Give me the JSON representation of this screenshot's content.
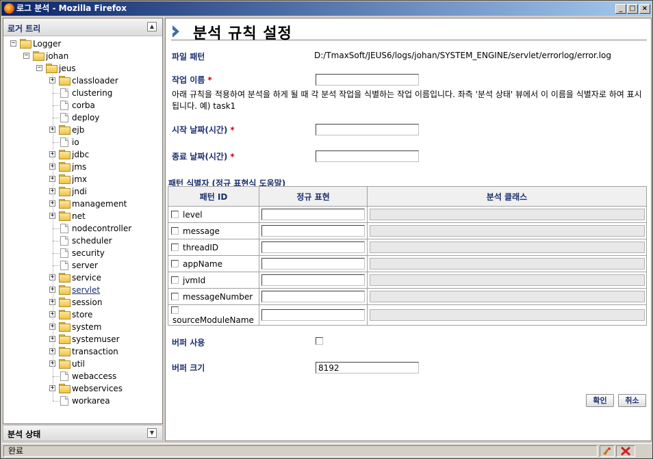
{
  "window": {
    "title": "로그 분석 - Mozilla Firefox"
  },
  "left": {
    "header": "로거 트리",
    "bottom_header": "분석 상태",
    "tree": [
      {
        "label": "Logger",
        "level": 0,
        "kind": "folder",
        "expander": "minus"
      },
      {
        "label": "johan",
        "level": 1,
        "kind": "folder",
        "expander": "minus"
      },
      {
        "label": "jeus",
        "level": 2,
        "kind": "folder",
        "expander": "minus"
      },
      {
        "label": "classloader",
        "level": 3,
        "kind": "folder",
        "expander": "plus"
      },
      {
        "label": "clustering",
        "level": 3,
        "kind": "doc",
        "expander": ""
      },
      {
        "label": "corba",
        "level": 3,
        "kind": "doc",
        "expander": ""
      },
      {
        "label": "deploy",
        "level": 3,
        "kind": "doc",
        "expander": ""
      },
      {
        "label": "ejb",
        "level": 3,
        "kind": "folder",
        "expander": "plus"
      },
      {
        "label": "io",
        "level": 3,
        "kind": "doc",
        "expander": ""
      },
      {
        "label": "jdbc",
        "level": 3,
        "kind": "folder",
        "expander": "plus"
      },
      {
        "label": "jms",
        "level": 3,
        "kind": "folder",
        "expander": "plus"
      },
      {
        "label": "jmx",
        "level": 3,
        "kind": "folder",
        "expander": "plus"
      },
      {
        "label": "jndi",
        "level": 3,
        "kind": "folder",
        "expander": "plus"
      },
      {
        "label": "management",
        "level": 3,
        "kind": "folder",
        "expander": "plus"
      },
      {
        "label": "net",
        "level": 3,
        "kind": "folder",
        "expander": "plus"
      },
      {
        "label": "nodecontroller",
        "level": 3,
        "kind": "doc",
        "expander": ""
      },
      {
        "label": "scheduler",
        "level": 3,
        "kind": "doc",
        "expander": ""
      },
      {
        "label": "security",
        "level": 3,
        "kind": "doc",
        "expander": ""
      },
      {
        "label": "server",
        "level": 3,
        "kind": "doc",
        "expander": ""
      },
      {
        "label": "service",
        "level": 3,
        "kind": "folder",
        "expander": "plus"
      },
      {
        "label": "servlet",
        "level": 3,
        "kind": "folder",
        "expander": "plus",
        "selected": true
      },
      {
        "label": "session",
        "level": 3,
        "kind": "folder",
        "expander": "plus"
      },
      {
        "label": "store",
        "level": 3,
        "kind": "folder",
        "expander": "plus"
      },
      {
        "label": "system",
        "level": 3,
        "kind": "folder",
        "expander": "plus"
      },
      {
        "label": "systemuser",
        "level": 3,
        "kind": "folder",
        "expander": "plus"
      },
      {
        "label": "transaction",
        "level": 3,
        "kind": "folder",
        "expander": "plus"
      },
      {
        "label": "util",
        "level": 3,
        "kind": "folder",
        "expander": "plus"
      },
      {
        "label": "webaccess",
        "level": 3,
        "kind": "doc",
        "expander": ""
      },
      {
        "label": "webservices",
        "level": 3,
        "kind": "folder",
        "expander": "plus"
      },
      {
        "label": "workarea",
        "level": 3,
        "kind": "doc",
        "expander": ""
      }
    ]
  },
  "main": {
    "title": "분석 규칙 설정",
    "file_path_label": "파일 패턴",
    "file_path_value": "D:/TmaxSoft/JEUS6/logs/johan/SYSTEM_ENGINE/servlet/errorlog/error.log",
    "task_name_label": "작업 이름",
    "task_name_value": "",
    "task_desc": "아래 규칙을 적용하여 분석을 하게 될 때 각 분석 작업을 식별하는 작업 이름입니다. 좌측 '분석 상태' 뷰에서 이 이름을 식별자로 하여 표시됩니다. 예) task1",
    "start_label": "시작 날짜(시간)",
    "start_value": "",
    "end_label": "종료 날짜(시간)",
    "end_value": "",
    "required_mark": "*",
    "pattern_section_label": "패턴 식별자 (정규 표현식 도움말)",
    "table_headers": [
      "패턴 ID",
      "정규 표현",
      "분석 클래스"
    ],
    "pattern_rows": [
      "level",
      "message",
      "threadID",
      "appName",
      "jvmId",
      "messageNumber",
      "sourceModuleName"
    ],
    "buffer_use_label": "버퍼 사용",
    "buffer_size_label": "버퍼 크기",
    "buffer_size_value": "8192",
    "ok_button": "확인",
    "cancel_button": "취소"
  },
  "status": {
    "text": "완료"
  },
  "colors": {
    "accent": "#1a2f6e",
    "required": "#d00000",
    "titlebar": "#0a246a"
  }
}
